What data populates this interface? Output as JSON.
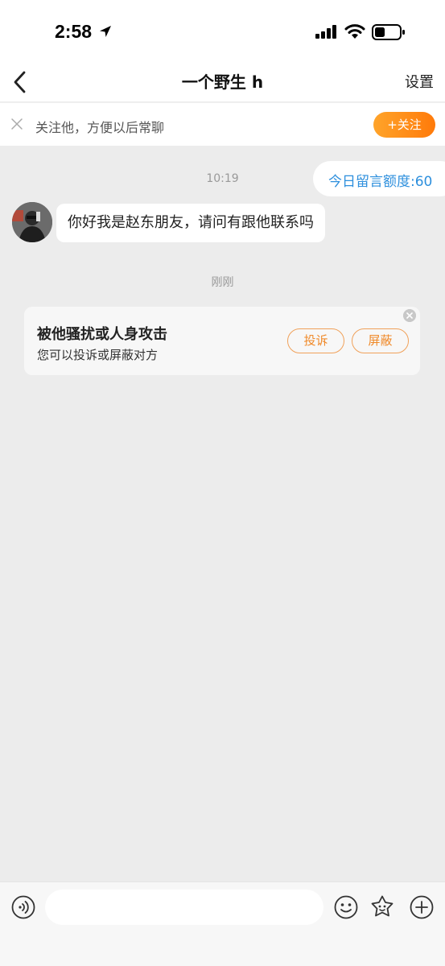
{
  "status_bar": {
    "time": "2:58",
    "icons": [
      "location-arrow-icon",
      "cellular-signal-icon",
      "wifi-icon",
      "battery-icon"
    ]
  },
  "nav": {
    "title": "一个野生 h",
    "settings_label": "设置",
    "back_icon": "chevron-left-icon"
  },
  "follow_banner": {
    "text": "关注他，方便以后常聊",
    "button_label": "+关注",
    "close_icon": "close-icon"
  },
  "chat": {
    "quota_text": "今日留言额度:60",
    "first_timestamp": "10:19",
    "messages": [
      {
        "sender": "other",
        "text": "你好我是赵东朋友，请问有跟他联系吗"
      }
    ],
    "second_timestamp": "刚刚"
  },
  "report_card": {
    "title": "被他骚扰或人身攻击",
    "subtitle": "您可以投诉或屏蔽对方",
    "report_label": "投诉",
    "block_label": "屏蔽"
  },
  "input_bar": {
    "placeholder": "",
    "icons": [
      "voice-icon",
      "emoji-icon",
      "sticker-icon",
      "plus-icon"
    ]
  },
  "colors": {
    "accent_orange": "#ff8a1a",
    "quota_blue": "#2d8fdd",
    "chat_background": "#ececec"
  }
}
